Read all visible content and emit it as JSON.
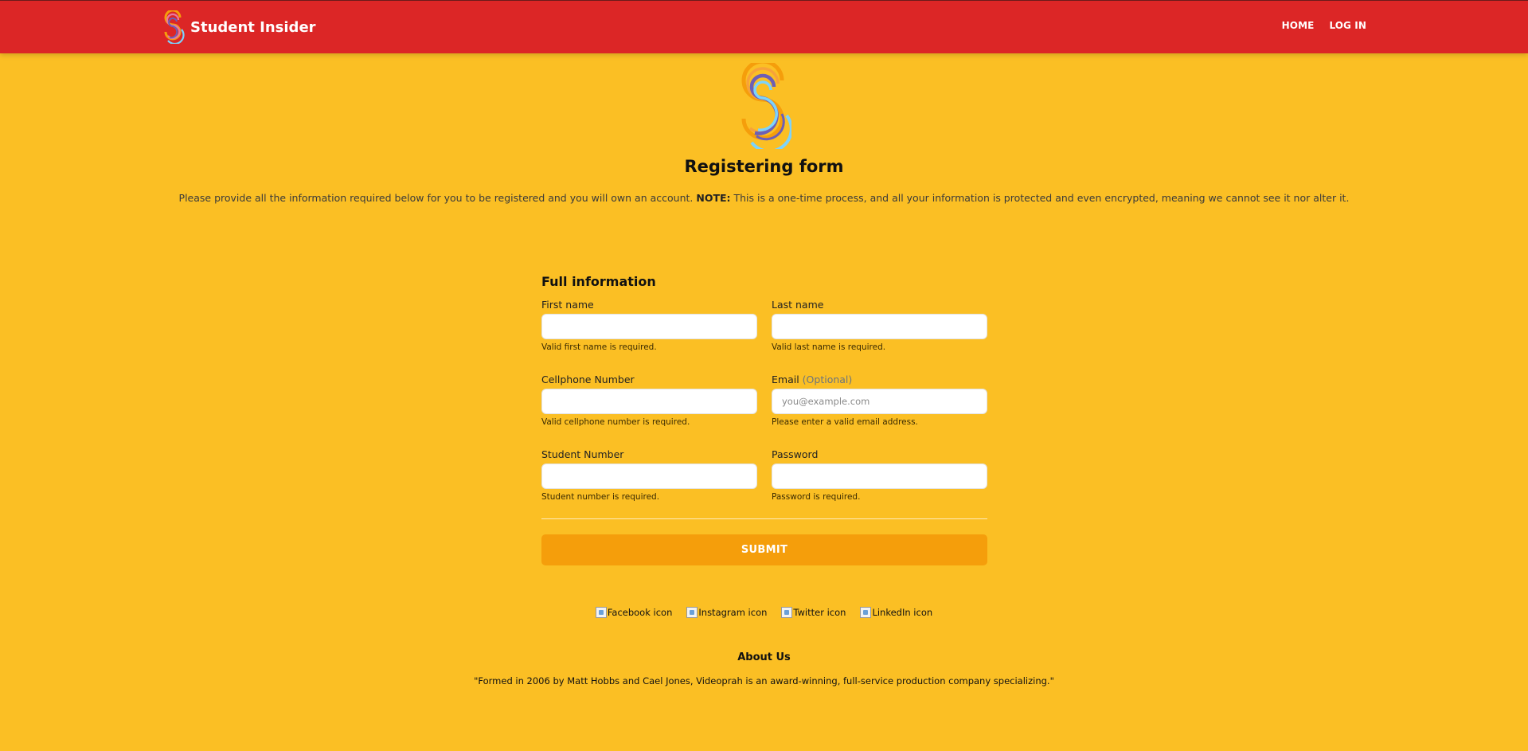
{
  "navbar": {
    "brand_name": "Student Insider",
    "brand_logo_icon": "ss-logo-icon",
    "links": [
      {
        "label": "HOME"
      },
      {
        "label": "LOG IN"
      }
    ]
  },
  "hero": {
    "logo_icon": "ss-logo-icon",
    "title": "Registering form",
    "lead_text": "Please provide all the information required below for you to be registered and you will own an account.",
    "lead_note_label": "NOTE:",
    "lead_note_text": "This is a one-time process, and all your information is protected and even encrypted, meaning we cannot see it nor alter it."
  },
  "form": {
    "section_title": "Full information",
    "first_name": {
      "label": "First name",
      "value": "",
      "help": "Valid first name is required."
    },
    "last_name": {
      "label": "Last name",
      "value": "",
      "help": "Valid last name is required."
    },
    "cellphone": {
      "label": "Cellphone Number",
      "value": "",
      "help": "Valid cellphone number is required."
    },
    "email": {
      "label": "Email",
      "optional": "(Optional)",
      "value": "",
      "placeholder": "you@example.com",
      "help": "Please enter a valid email address."
    },
    "student_number": {
      "label": "Student Number",
      "value": "",
      "help": "Student number is required."
    },
    "password": {
      "label": "Password",
      "value": "",
      "help": "Password is required."
    },
    "submit_label": "SUBMIT"
  },
  "footer": {
    "socials": [
      {
        "alt": "Facebook icon"
      },
      {
        "alt": "Instagram icon"
      },
      {
        "alt": "Twitter icon"
      },
      {
        "alt": "LinkedIn icon"
      }
    ],
    "about_title": "About Us",
    "about_text": "\"Formed in 2006 by Matt Hobbs and Cael Jones, Videoprah is an award-winning, full-service production company specializing.\""
  },
  "colors": {
    "navbar_bg": "#dc2626",
    "page_bg": "#fbbf24",
    "submit_bg": "#f59e0b"
  }
}
